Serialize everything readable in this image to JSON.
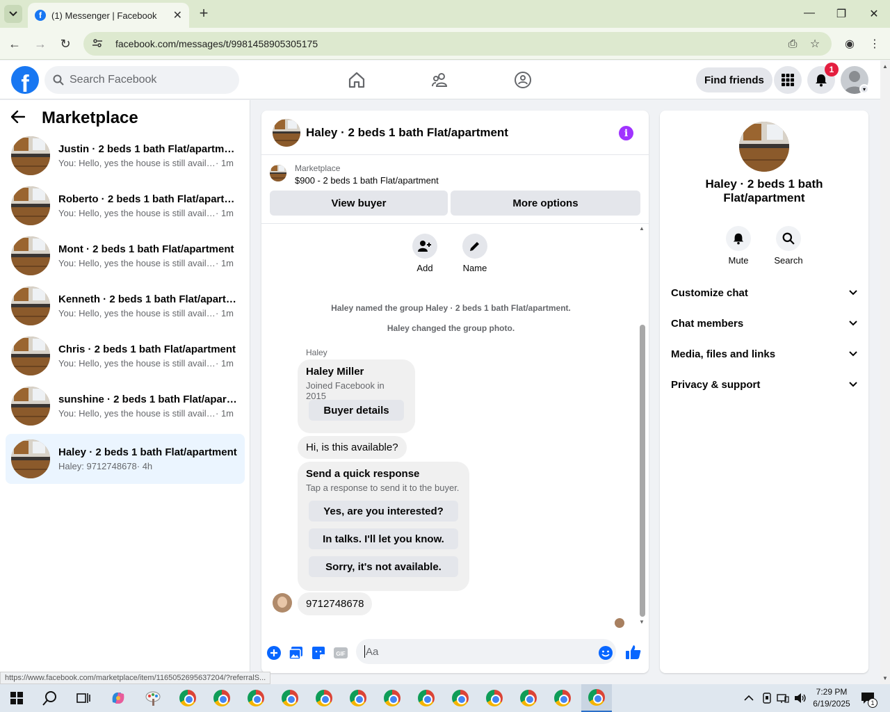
{
  "browser": {
    "tab_title": "(1) Messenger | Facebook",
    "url": "facebook.com/messages/t/9981458905305175",
    "status_url": "https://www.facebook.com/marketplace/item/1165052695637204/?referralS..."
  },
  "header": {
    "search_placeholder": "Search Facebook",
    "find_friends": "Find friends",
    "notification_count": "1",
    "brand_color": "#1877f2"
  },
  "sidebar": {
    "title": "Marketplace",
    "conversations": [
      {
        "name": "Justin · 2 beds 1 bath Flat/apartment",
        "snippet": "You: Hello, yes the house is still availa...",
        "time": "· 1m"
      },
      {
        "name": "Roberto · 2 beds 1 bath Flat/apartment",
        "snippet": "You: Hello, yes the house is still availa...",
        "time": "· 1m"
      },
      {
        "name": "Mont · 2 beds 1 bath Flat/apartment",
        "snippet": "You: Hello, yes the house is still availa...",
        "time": "· 1m"
      },
      {
        "name": "Kenneth · 2 beds 1 bath Flat/apartment",
        "snippet": "You: Hello, yes the house is still availa...",
        "time": "· 1m"
      },
      {
        "name": "Chris · 2 beds 1 bath Flat/apartment",
        "snippet": "You: Hello, yes the house is still availa...",
        "time": "· 1m"
      },
      {
        "name": "sunshine · 2 beds 1 bath Flat/apartment",
        "snippet": "You: Hello, yes the house is still availa...",
        "time": "· 1m"
      },
      {
        "name": "Haley · 2 beds 1 bath Flat/apartment",
        "snippet": "Haley: 9712748678",
        "time": " · 4h"
      }
    ]
  },
  "chat": {
    "title": "Haley · 2 beds 1 bath Flat/apartment",
    "listing_label": "Marketplace",
    "listing_text": "$900 - 2 beds 1 bath Flat/apartment",
    "view_buyer": "View buyer",
    "more_options": "More options",
    "add_label": "Add",
    "name_label": "Name",
    "system_1": "Haley named the group Haley · 2 beds 1 bath Flat/apartment.",
    "system_2": "Haley changed the group photo.",
    "sender": "Haley",
    "buyer_name": "Haley Miller",
    "buyer_joined": "Joined Facebook in 2015",
    "buyer_details": "Buyer details",
    "message_1": "Hi, is this available?",
    "quick_title": "Send a quick response",
    "quick_sub": "Tap a response to send it to the buyer.",
    "quick_1": "Yes, are you interested?",
    "quick_2": "In talks. I'll let you know.",
    "quick_3": "Sorry, it's not available.",
    "message_2": "9712748678",
    "composer_placeholder": "Aa"
  },
  "details": {
    "name": "Haley · 2 beds 1 bath Flat/apartment",
    "mute": "Mute",
    "search": "Search",
    "sections": [
      "Customize chat",
      "Chat members",
      "Media, files and links",
      "Privacy & support"
    ]
  },
  "taskbar": {
    "time": "7:29 PM",
    "date": "6/19/2025",
    "notif_count": "1"
  }
}
